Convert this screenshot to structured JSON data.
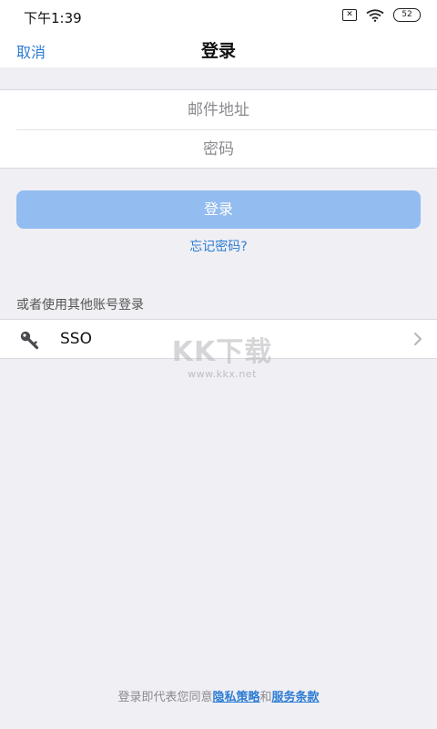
{
  "status_bar": {
    "time": "下午1:39",
    "battery": "52",
    "sim": "✕"
  },
  "nav": {
    "cancel_label": "取消",
    "title": "登录"
  },
  "form": {
    "email_placeholder": "邮件地址",
    "email_value": "",
    "password_placeholder": "密码",
    "password_value": ""
  },
  "login_button": {
    "label": "登录"
  },
  "forgot_password": {
    "label": "忘记密码?"
  },
  "other_login": {
    "header": "或者使用其他账号登录",
    "options": [
      {
        "label": "SSO",
        "icon": "key-icon"
      }
    ]
  },
  "watermark": {
    "main": "KK下载",
    "sub": "www.kkx.net"
  },
  "footer": {
    "prefix": "登录即代表您同意",
    "privacy_label": "隐私策略",
    "joiner": "和",
    "terms_label": "服务条款"
  },
  "colors": {
    "accent": "#2d7cd4",
    "button_disabled": "#93bcf0",
    "background": "#efeff4"
  }
}
